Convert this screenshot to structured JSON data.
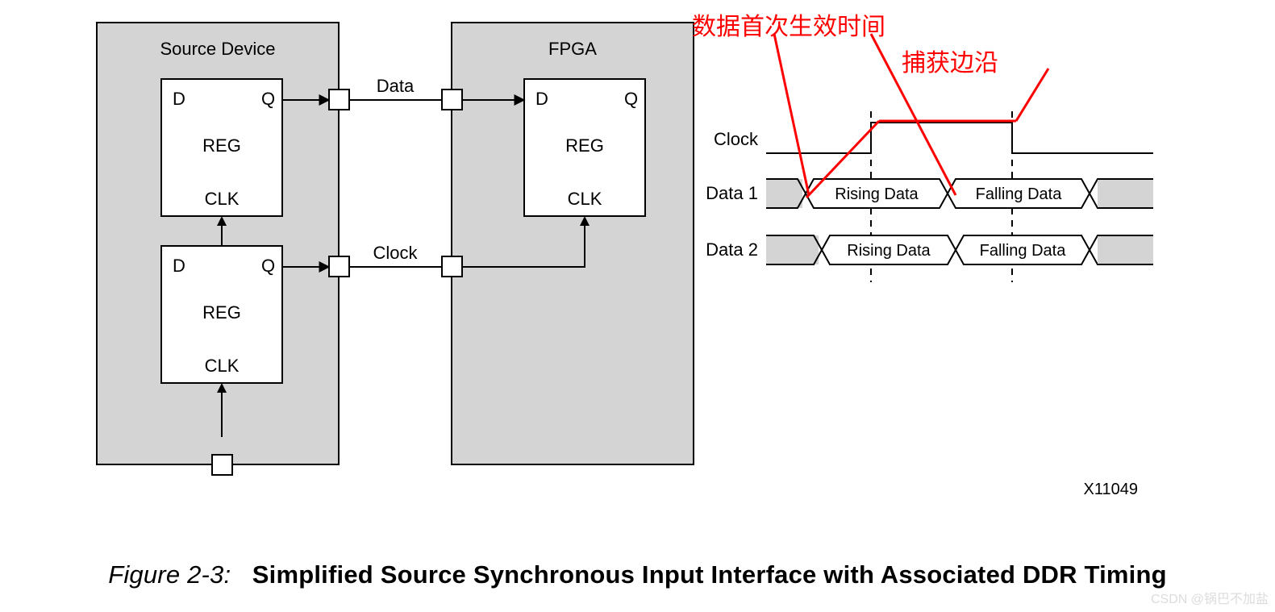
{
  "caption": {
    "prefix": "Figure 2-3:",
    "title": "Simplified Source Synchronous Input Interface with Associated DDR Timing"
  },
  "xref": "X11049",
  "watermark": "CSDN @锅巴不加盐",
  "blockdiagram": {
    "source_title": "Source Device",
    "fpga_title": "FPGA",
    "data_label": "Data",
    "clock_label": "Clock",
    "reg": {
      "d": "D",
      "q": "Q",
      "reg": "REG",
      "clk": "CLK"
    }
  },
  "timing": {
    "clock_label": "Clock",
    "data1_label": "Data 1",
    "data2_label": "Data 2",
    "rising": "Rising Data",
    "falling": "Falling Data"
  },
  "annotations": {
    "valid_time": "数据首次生效时间",
    "capture_edge": "捕获边沿"
  }
}
